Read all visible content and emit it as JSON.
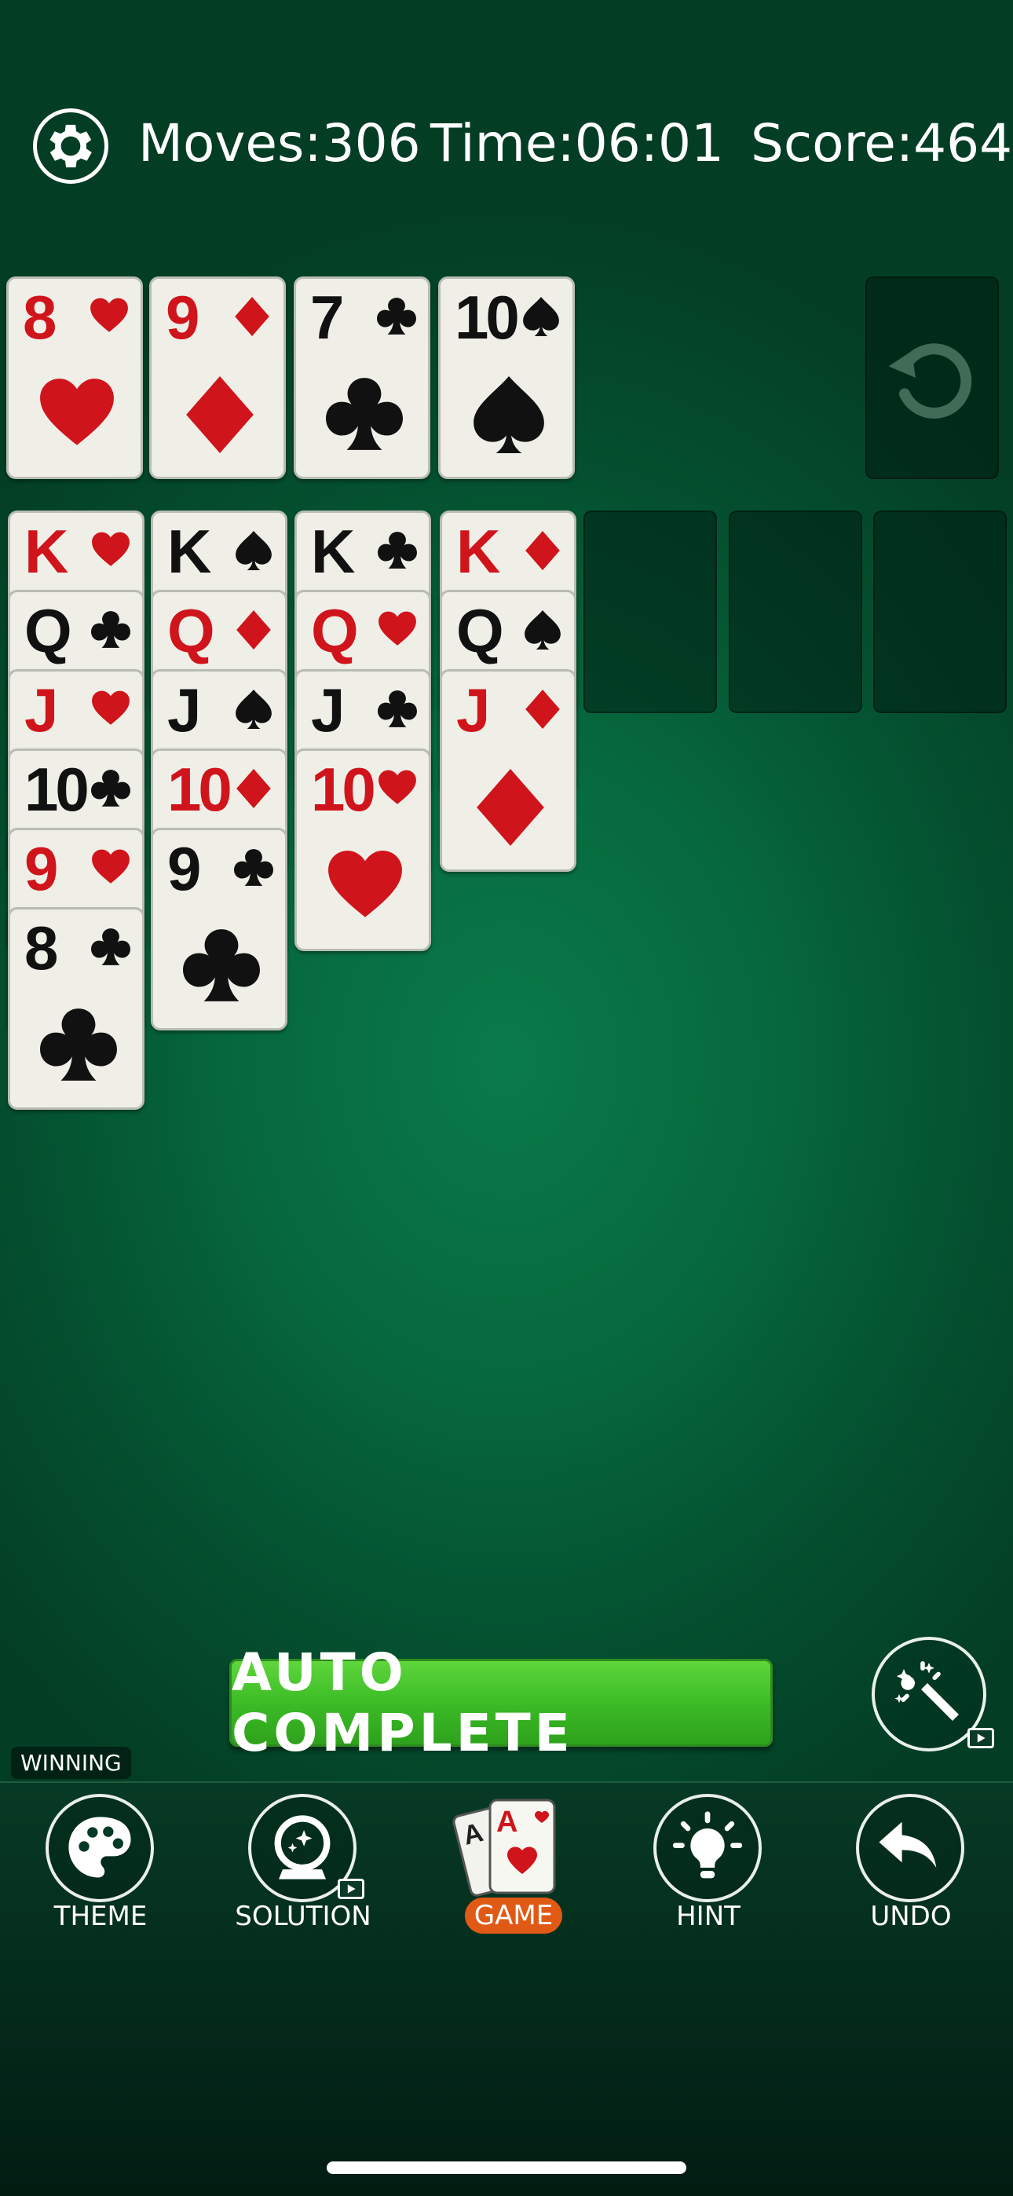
{
  "header": {
    "moves_label": "Moves:306",
    "time_label": "Time:06:01",
    "score_label": "Score:464",
    "settings_icon": "gear-icon"
  },
  "foundations": [
    {
      "rank": "8",
      "suit": "heart",
      "color": "red"
    },
    {
      "rank": "9",
      "suit": "diamond",
      "color": "red"
    },
    {
      "rank": "7",
      "suit": "club",
      "color": "black"
    },
    {
      "rank": "10",
      "suit": "spade",
      "color": "black"
    }
  ],
  "stock": {
    "icon": "recycle-icon"
  },
  "tableau": [
    [
      {
        "rank": "K",
        "suit": "heart",
        "color": "red"
      },
      {
        "rank": "Q",
        "suit": "club",
        "color": "black"
      },
      {
        "rank": "J",
        "suit": "heart",
        "color": "red"
      },
      {
        "rank": "10",
        "suit": "club",
        "color": "black"
      },
      {
        "rank": "9",
        "suit": "heart",
        "color": "red"
      },
      {
        "rank": "8",
        "suit": "club",
        "color": "black"
      }
    ],
    [
      {
        "rank": "K",
        "suit": "spade",
        "color": "black"
      },
      {
        "rank": "Q",
        "suit": "diamond",
        "color": "red"
      },
      {
        "rank": "J",
        "suit": "spade",
        "color": "black"
      },
      {
        "rank": "10",
        "suit": "diamond",
        "color": "red"
      },
      {
        "rank": "9",
        "suit": "club",
        "color": "black"
      }
    ],
    [
      {
        "rank": "K",
        "suit": "club",
        "color": "black"
      },
      {
        "rank": "Q",
        "suit": "heart",
        "color": "red"
      },
      {
        "rank": "J",
        "suit": "club",
        "color": "black"
      },
      {
        "rank": "10",
        "suit": "heart",
        "color": "red"
      }
    ],
    [
      {
        "rank": "K",
        "suit": "diamond",
        "color": "red"
      },
      {
        "rank": "Q",
        "suit": "spade",
        "color": "black"
      },
      {
        "rank": "J",
        "suit": "diamond",
        "color": "red"
      }
    ],
    [],
    [],
    []
  ],
  "actions": {
    "auto_complete_label": "AUTO COMPLETE",
    "magic_icon": "magic-wand-icon",
    "winning_label": "WINNING"
  },
  "nav": {
    "theme": "THEME",
    "solution": "SOLUTION",
    "game": "GAME",
    "hint": "HINT",
    "undo": "UNDO"
  },
  "colors": {
    "red_suit": "#d0141b",
    "black_suit": "#111111",
    "felt": "#066a3e",
    "button_green": "#3cbc26",
    "game_badge": "#e05a16"
  }
}
